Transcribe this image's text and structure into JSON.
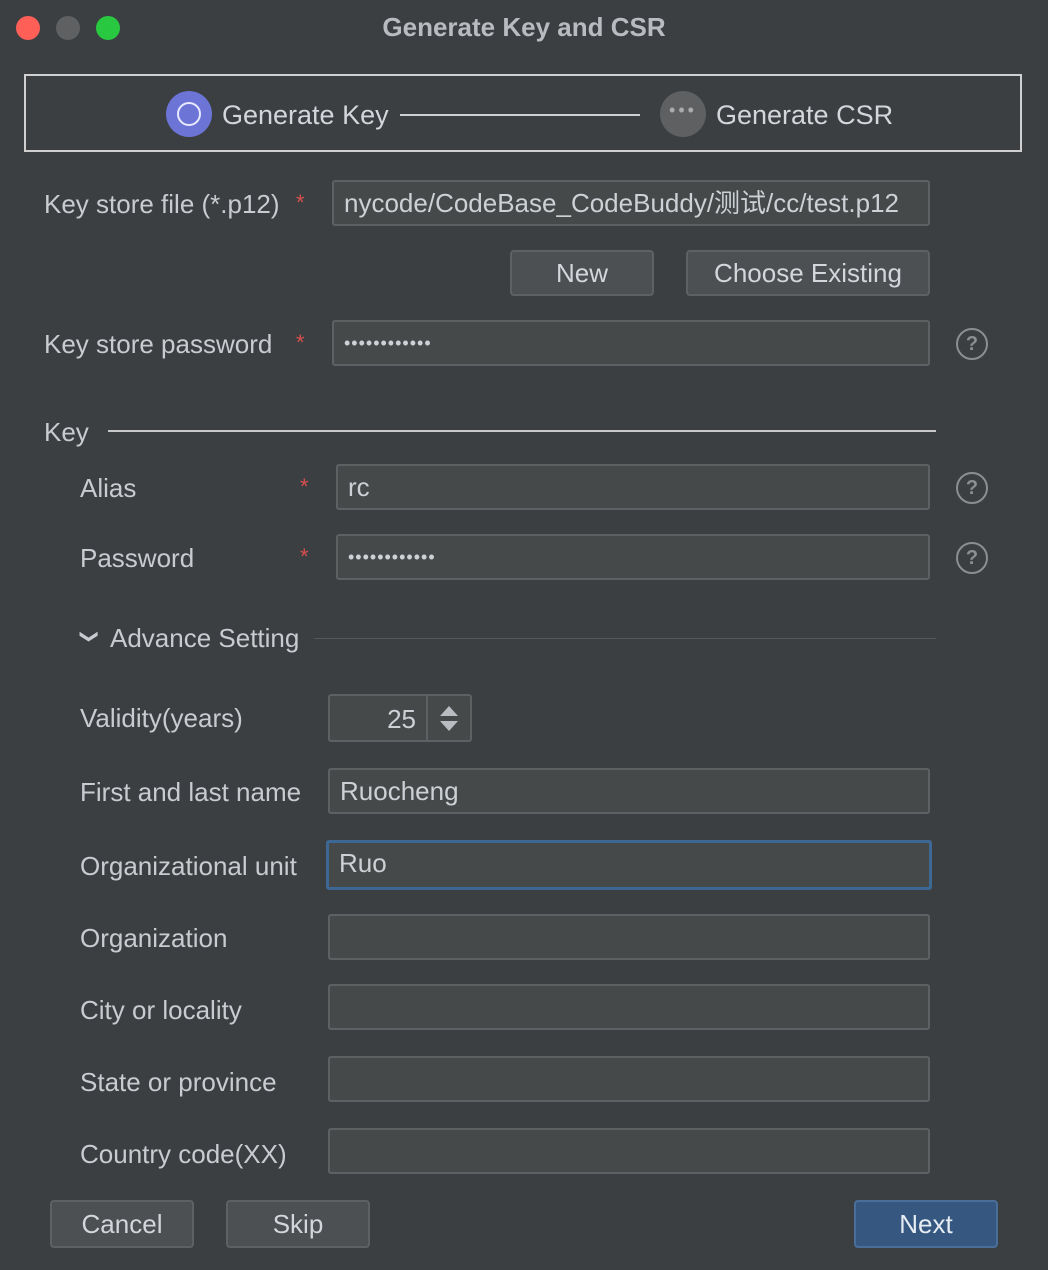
{
  "window": {
    "title": "Generate Key and CSR"
  },
  "steps": [
    {
      "label": "Generate Key",
      "icon": "circle-progress-icon"
    },
    {
      "label": "Generate CSR",
      "icon": "ellipsis-icon"
    }
  ],
  "keystore": {
    "file_label": "Key store file (*.p12)",
    "file_value": "nycode/CodeBase_CodeBuddy/测试/cc/test.p12",
    "new_label": "New",
    "choose_label": "Choose Existing",
    "password_label": "Key store password",
    "password_value": "••••••••••••"
  },
  "key": {
    "section_label": "Key",
    "alias_label": "Alias",
    "alias_value": "rc",
    "password_label": "Password",
    "password_value": "••••••••••••"
  },
  "advance": {
    "section_label": "Advance Setting",
    "validity_label": "Validity(years)",
    "validity_value": "25",
    "name_label": "First and last name",
    "name_value": "Ruocheng",
    "org_unit_label": "Organizational unit",
    "org_unit_value": "Ruo",
    "org_label": "Organization",
    "org_value": "",
    "city_label": "City or locality",
    "city_value": "",
    "state_label": "State or province",
    "state_value": "",
    "country_label": "Country code(XX)",
    "country_value": ""
  },
  "required_mark": "*",
  "help_glyph": "?",
  "footer": {
    "cancel": "Cancel",
    "skip": "Skip",
    "next": "Next"
  },
  "colors": {
    "accent": "#365880",
    "step_active": "#6c74d6",
    "required": "#d94f4f",
    "focus": "#3e6894"
  }
}
